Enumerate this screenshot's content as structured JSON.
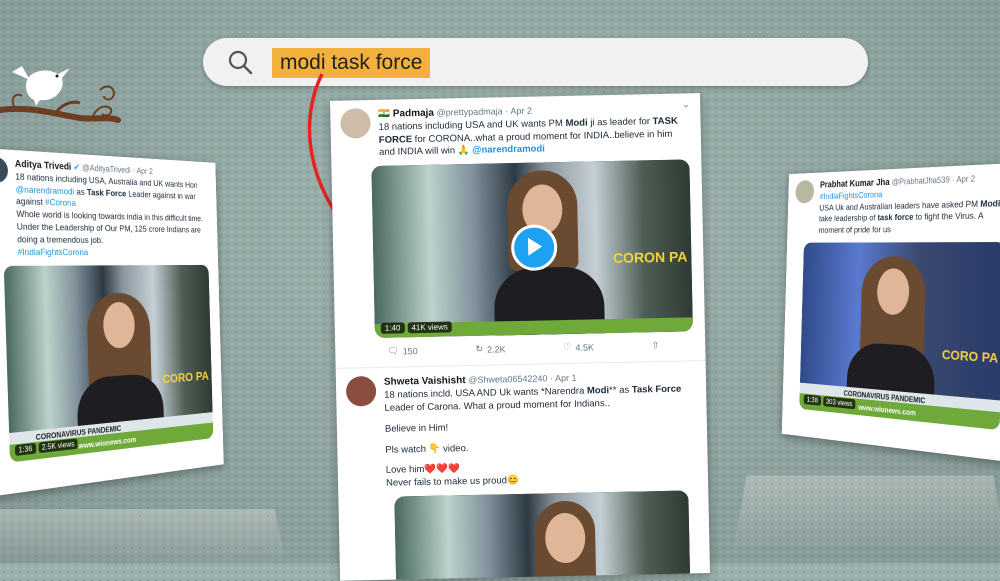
{
  "search": {
    "query": "modi task force"
  },
  "tweet_left": {
    "name": "Aditya Trivedi",
    "handle": "@AdityaTrivedi",
    "date": "Apr 2",
    "line1": "18 nations including USA, Australia and UK wants Hon ",
    "mention": "@narendramodi",
    "line1_end": " as",
    "bold_phrase": "Task Force",
    "line2": " Leader against in war against ",
    "hashtag1": "#Corona",
    "line3": "Whole world is looking towards india in this difficult time. Under the Leadership of Our PM, 125 crore Indians are doing a tremendous job.",
    "hashtag2": "#IndiaFightsCorona",
    "video_time": "1:36",
    "video_views": "2.5K views",
    "ticker": "CORONAVIRUS PANDEMIC",
    "site": "www.wionews.com",
    "corona": "CORO PA"
  },
  "tweet_center": {
    "flag": "🇮🇳",
    "name": "Padmaja",
    "handle": "@prettypadmaja",
    "date": "Apr 2",
    "text_a": "18 nations including USA and UK wants PM ",
    "bold1": "Modi",
    "text_b": " ji  as leader for ",
    "bold2": "TASK FORCE",
    "text_c": " for CORONA..what a proud moment for INDIA..believe in him and INDIA will win 🙏 ",
    "mention": "@narendramodi",
    "video_time": "1:40",
    "video_views": "41K views",
    "corona": "CORON PA",
    "replies": "150",
    "retweets": "2.2K",
    "likes": "4.5K"
  },
  "tweet_center2": {
    "name": "Shweta Vaishisht",
    "handle": "@Shweta06542240",
    "date": "Apr 1",
    "text_a": "18 nations incld. USA AND Uk wants *Narendra ",
    "bold1": "Modi",
    "text_b": "** as ",
    "bold2": "Task Force",
    "text_c": " Leader of Carona. What a proud moment for Indians..",
    "line2": "Believe in Him!",
    "line3": "Pls watch 👇 video.",
    "line4": "Love him❤️❤️❤️",
    "line5": "Never fails to make us proud😊"
  },
  "tweet_right": {
    "name": "Prabhat Kumar Jha",
    "handle": "@PrabhatJha539",
    "date": "Apr 2",
    "hashtag": "#IndiaFightsCorona",
    "text_a": "USA Uk and Australian leaders have asked PM ",
    "bold1": "Modi",
    "text_b": " to take leadership of ",
    "bold2": "task force",
    "text_c": " to fight the Virus. A moment of pride for us",
    "video_time": "1:38",
    "video_views": "303 views",
    "ticker": "CORONAVIRUS PANDEMIC",
    "site": "www.wionews.com",
    "corona": "CORO PA"
  },
  "colors": {
    "highlight": "#f2b13d",
    "twitter_blue": "#1da1f2",
    "arrow_red": "#e52420",
    "background": "#9bb0ac"
  }
}
